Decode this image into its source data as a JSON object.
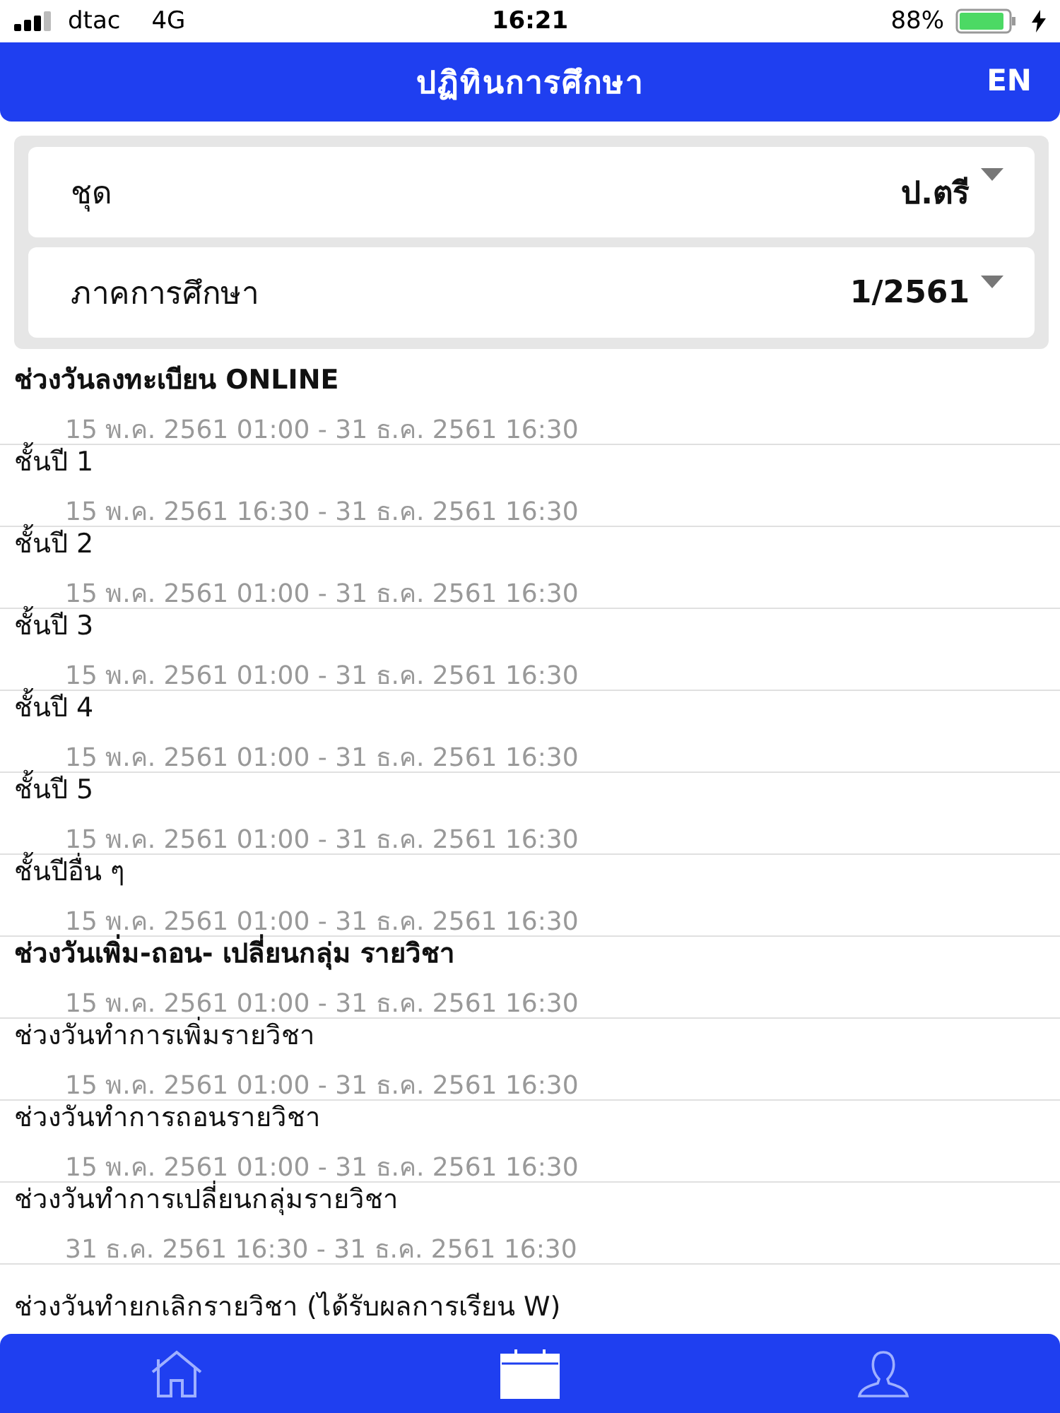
{
  "status_bar": {
    "carrier": "dtac",
    "network": "4G",
    "time": "16:21",
    "battery": "88%"
  },
  "header": {
    "title": "ปฏิทินการศึกษา",
    "language": "EN"
  },
  "filters": [
    {
      "label": "ชุด",
      "value": "ป.ตรี"
    },
    {
      "label": "ภาคการศึกษา",
      "value": "1/2561"
    }
  ],
  "periods": [
    {
      "title": "ช่วงวันลงทะเบียน ONLINE",
      "range": "15 พ.ค. 2561 01:00 - 31 ธ.ค. 2561 16:30"
    },
    {
      "title": "ชั้นปี 1",
      "range": "15 พ.ค. 2561 16:30 - 31 ธ.ค. 2561 16:30"
    },
    {
      "title": "ชั้นปี 2",
      "range": "15 พ.ค. 2561 01:00 - 31 ธ.ค. 2561 16:30"
    },
    {
      "title": "ชั้นปี 3",
      "range": "15 พ.ค. 2561 01:00 - 31 ธ.ค. 2561 16:30"
    },
    {
      "title": "ชั้นปี 4",
      "range": "15 พ.ค. 2561 01:00 - 31 ธ.ค. 2561 16:30"
    },
    {
      "title": "ชั้นปี 5",
      "range": "15 พ.ค. 2561 01:00 - 31 ธ.ค. 2561 16:30"
    },
    {
      "title": "ชั้นปีอื่น ๆ",
      "range": "15 พ.ค. 2561 01:00 - 31 ธ.ค. 2561 16:30"
    },
    {
      "title": "ช่วงวันเพิ่ม-ถอน- เปลี่ยนกลุ่ม รายวิชา",
      "range": "15 พ.ค. 2561 01:00 - 31 ธ.ค. 2561 16:30"
    },
    {
      "title": "ช่วงวันทำการเพิ่มรายวิชา",
      "range": "15 พ.ค. 2561 01:00 - 31 ธ.ค. 2561 16:30"
    },
    {
      "title": "ช่วงวันทำการถอนรายวิชา",
      "range": "15 พ.ค. 2561 01:00 - 31 ธ.ค. 2561 16:30"
    },
    {
      "title": "ช่วงวันทำการเปลี่ยนกลุ่มรายวิชา",
      "range": "31 ธ.ค. 2561 16:30 - 31 ธ.ค. 2561 16:30"
    },
    {
      "title": "ช่วงวันทำยกเลิกรายวิชา (ได้รับผลการเรียน W)"
    }
  ],
  "tab_bar": [
    {
      "kind": "home",
      "selected": false
    },
    {
      "kind": "calendar",
      "selected": true
    },
    {
      "kind": "profile",
      "selected": false
    }
  ]
}
